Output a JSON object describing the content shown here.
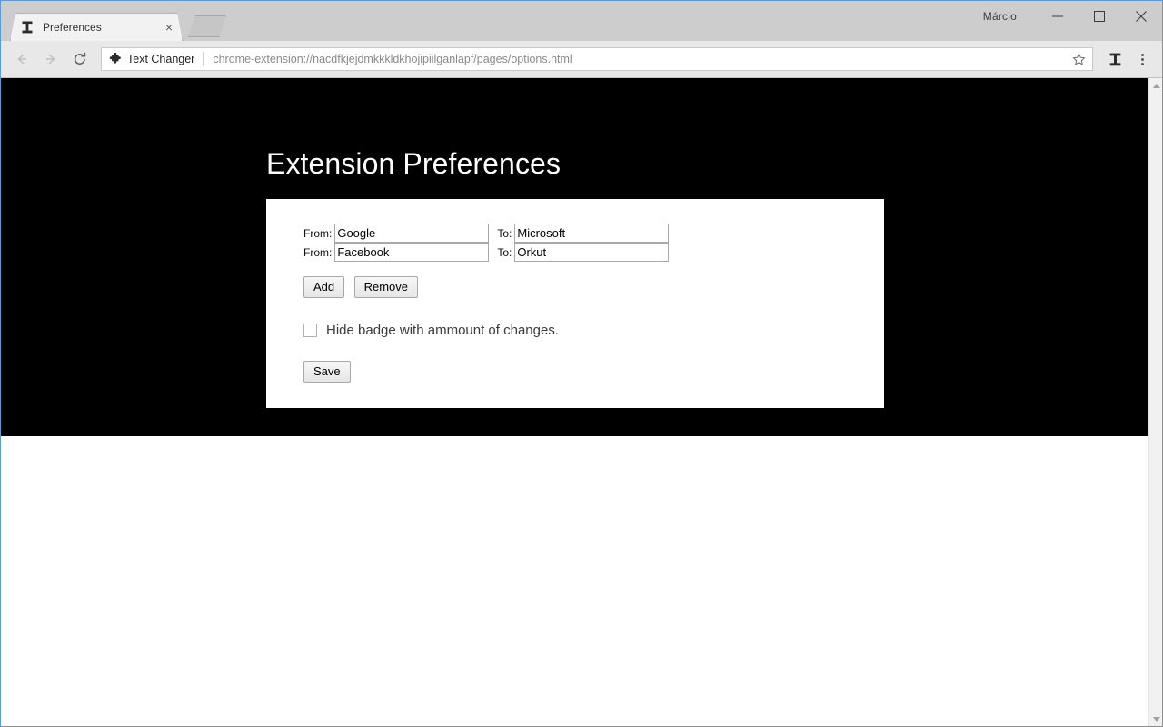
{
  "browser": {
    "user_label": "Márcio",
    "tab": {
      "title": "Preferences",
      "favicon": "text-changer-icon",
      "close": "×"
    },
    "window_controls": {
      "minimize": "—",
      "maximize": "◻",
      "close": "✕"
    },
    "toolbar": {
      "back": "←",
      "forward": "→",
      "reload": "⟳",
      "extension_chip_name": "Text Changer",
      "url": "chrome-extension://nacdfkjejdmkkkldkhojipiilganlapf/pages/options.html",
      "bookmark_star": "☆",
      "extension_button": "text-changer-icon",
      "menu": "⋮"
    }
  },
  "page": {
    "title": "Extension Preferences",
    "background_color": "#000000",
    "card_color": "#ffffff",
    "rules": [
      {
        "from_label": "From:",
        "from_value": "Google",
        "to_label": "To:",
        "to_value": "Microsoft"
      },
      {
        "from_label": "From:",
        "from_value": "Facebook",
        "to_label": "To:",
        "to_value": "Orkut"
      }
    ],
    "buttons": {
      "add": "Add",
      "remove": "Remove",
      "save": "Save"
    },
    "checkbox": {
      "label": "Hide badge with ammount of changes.",
      "checked": false
    }
  }
}
